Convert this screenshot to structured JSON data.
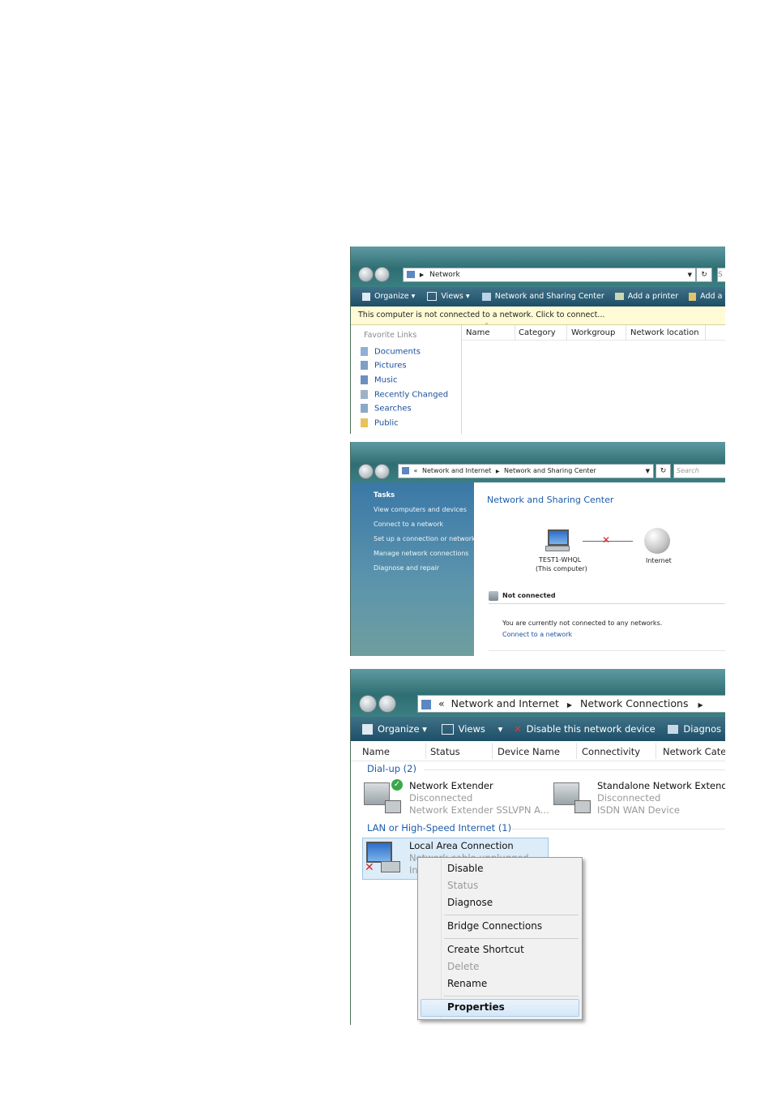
{
  "shot1": {
    "breadcrumb": "Network",
    "search_glyph": "S",
    "toolbar": [
      "Organize",
      "Views",
      "Network and Sharing Center",
      "Add a printer",
      "Add a wire"
    ],
    "infobar": "This computer is not connected to a network. Click to connect...",
    "favorites_title": "Favorite Links",
    "favorites": [
      "Documents",
      "Pictures",
      "Music",
      "Recently Changed",
      "Searches",
      "Public"
    ],
    "columns": [
      "Name",
      "Category",
      "Workgroup",
      "Network location"
    ]
  },
  "shot2": {
    "breadcrumb": [
      "Network and Internet",
      "Network and Sharing Center"
    ],
    "search_placeholder": "Search",
    "tasks_title": "Tasks",
    "tasks": [
      "View computers and devices",
      "Connect to a network",
      "Set up a connection or network",
      "Manage network connections",
      "Diagnose and repair"
    ],
    "heading": "Network and Sharing Center",
    "computer_name": "TEST1-WHQL",
    "computer_sub": "(This computer)",
    "internet_label": "Internet",
    "status_title": "Not connected",
    "status_text": "You are currently not connected to any networks.",
    "status_link": "Connect to a network"
  },
  "shot3": {
    "breadcrumb": [
      "Network and Internet",
      "Network Connections"
    ],
    "toolbar": [
      "Organize",
      "Views",
      "Disable this network device",
      "Diagnos"
    ],
    "columns": [
      "Name",
      "Status",
      "Device Name",
      "Connectivity",
      "Network Cate"
    ],
    "group1": "Dial-up (2)",
    "conn1": {
      "name": "Network Extender",
      "status": "Disconnected",
      "device": "Network Extender SSLVPN A..."
    },
    "conn2": {
      "name": "Standalone Network Extende",
      "status": "Disconnected",
      "device": "ISDN WAN Device"
    },
    "group2": "LAN or High-Speed Internet (1)",
    "conn3": {
      "name": "Local Area Connection",
      "status": "Network cable unplugged",
      "device_fragment": "In"
    },
    "menu": {
      "disable": "Disable",
      "status": "Status",
      "diagnose": "Diagnose",
      "bridge": "Bridge Connections",
      "shortcut": "Create Shortcut",
      "delete": "Delete",
      "rename": "Rename",
      "properties": "Properties"
    }
  }
}
